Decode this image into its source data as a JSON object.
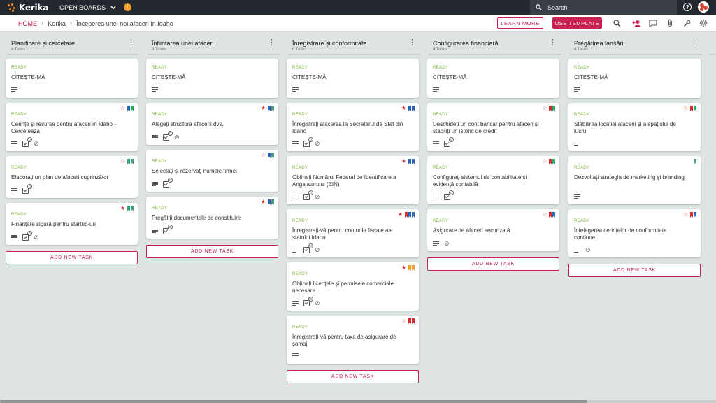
{
  "topbar": {
    "logo_text": "Kerika",
    "open_boards_label": "OPEN BOARDS",
    "search_placeholder": "Search",
    "help_label": "?"
  },
  "header": {
    "breadcrumb": [
      "HOME",
      "Kerika",
      "Începerea unei noi afaceri în Idaho"
    ],
    "learn_more_label": "LEARN MORE",
    "use_template_label": "USE TEMPLATE"
  },
  "colors": {
    "accent": "#c8204f",
    "ready": "#7fb23a",
    "topbar": "#23272e",
    "board_bg": "#dde4e3",
    "tag_blue": "#2e64b8",
    "tag_green": "#2fa66a",
    "tag_red": "#d42f2f",
    "tag_orange": "#f29b26",
    "tag_teal": "#4a9a8a"
  },
  "add_task_label": "ADD NEW TASK",
  "columns": [
    {
      "title": "Planificare și cercetare",
      "count": "4 Tasks",
      "cards": [
        {
          "status": "READY",
          "title": "CITEȘTE-MĂ",
          "star": "",
          "tags": [],
          "icons": [
            "desc"
          ]
        },
        {
          "status": "READY",
          "title": "Cerințe și resurse pentru afaceri în Idaho - Cercetează",
          "star": "outline",
          "tags": [
            "blue",
            "green"
          ],
          "icons": [
            "desc",
            "check",
            "clip"
          ]
        },
        {
          "status": "READY",
          "title": "Elaborați un plan de afaceri cuprinzător",
          "star": "outline",
          "tags": [
            "green",
            "teal"
          ],
          "icons": [
            "desc",
            "check"
          ]
        },
        {
          "status": "READY",
          "title": "Finanțare sigură pentru startup-uri",
          "star": "filled",
          "tags": [
            "green",
            "teal"
          ],
          "icons": [
            "desc",
            "check",
            "clip"
          ]
        }
      ]
    },
    {
      "title": "Înființarea unei afaceri",
      "count": "4 Tasks",
      "cards": [
        {
          "status": "READY",
          "title": "CITEȘTE-MĂ",
          "star": "",
          "tags": [],
          "icons": [
            "desc"
          ]
        },
        {
          "status": "READY",
          "title": "Alegeți structura afacerii dvs.",
          "star": "filled",
          "tags": [
            "blue",
            "teal"
          ],
          "icons": [
            "desc",
            "check",
            "clip"
          ]
        },
        {
          "status": "READY",
          "title": "Selectați și rezervați numele firmei",
          "star": "outline",
          "tags": [
            "blue",
            "teal"
          ],
          "icons": [
            "desc",
            "check"
          ]
        },
        {
          "status": "READY",
          "title": "Pregătiți documentele de constituire",
          "star": "filled",
          "tags": [
            "blue",
            "teal"
          ],
          "icons": [
            "desc",
            "check"
          ]
        }
      ]
    },
    {
      "title": "Înregistrare și conformitate",
      "count": "6 Tasks",
      "cards": [
        {
          "status": "READY",
          "title": "CITEȘTE-MĂ",
          "star": "",
          "tags": [],
          "icons": [
            "desc"
          ]
        },
        {
          "status": "READY",
          "title": "Înregistrați afacerea la Secretarul de Stat din Idaho",
          "star": "filled",
          "tags": [
            "blue",
            "blue"
          ],
          "icons": [
            "desc",
            "check",
            "clip"
          ]
        },
        {
          "status": "READY",
          "title": "Obțineți Numărul Federal de Identificare a Angajatorului (EIN)",
          "star": "filled",
          "tags": [
            "blue",
            "blue"
          ],
          "icons": [
            "desc",
            "check",
            "clip"
          ]
        },
        {
          "status": "READY",
          "title": "Înregistrați-vă pentru conturile fiscale ale statului Idaho",
          "star": "filled",
          "tags": [
            "red",
            "blue",
            "blue"
          ],
          "icons": [
            "desc",
            "check",
            "clip"
          ]
        },
        {
          "status": "READY",
          "title": "Obțineți licențele și permisele comerciale necesare",
          "star": "filled",
          "tags": [
            "orange",
            "orange"
          ],
          "icons": [
            "desc",
            "check",
            "clip"
          ]
        },
        {
          "status": "READY",
          "title": "Înregistrați-vă pentru taxa de asigurare de șomaj",
          "star": "outline",
          "tags": [
            "red",
            "red"
          ],
          "icons": [
            "desc"
          ]
        }
      ]
    },
    {
      "title": "Configurarea financiară",
      "count": "4 Tasks",
      "cards": [
        {
          "status": "READY",
          "title": "CITEȘTE-MĂ",
          "star": "",
          "tags": [],
          "icons": [
            "desc"
          ]
        },
        {
          "status": "READY",
          "title": "Deschideți un cont bancar pentru afaceri și stabiliți un istoric de credit",
          "star": "outline",
          "tags": [
            "red",
            "green"
          ],
          "icons": [
            "desc",
            "check"
          ]
        },
        {
          "status": "READY",
          "title": "Configurați sistemul de contabilitate și evidență contabilă",
          "star": "outline",
          "tags": [
            "red",
            "green"
          ],
          "icons": [
            "desc",
            "check"
          ]
        },
        {
          "status": "READY",
          "title": "Asigurare de afaceri securizată",
          "star": "outline",
          "tags": [
            "red",
            "blue"
          ],
          "icons": [
            "desc",
            "clip"
          ]
        }
      ]
    },
    {
      "title": "Pregătirea lansării",
      "count": "4 Tasks",
      "cards": [
        {
          "status": "READY",
          "title": "CITEȘTE-MĂ",
          "star": "",
          "tags": [],
          "icons": [
            "desc"
          ]
        },
        {
          "status": "READY",
          "title": "Stabilirea locației afacerii și a spațiului de lucru",
          "star": "outline",
          "tags": [
            "red",
            "green"
          ],
          "icons": [
            "desc"
          ]
        },
        {
          "status": "READY",
          "title": "Dezvoltați strategia de marketing și branding",
          "star": "",
          "tags": [
            "teal"
          ],
          "icons": [
            "desc"
          ]
        },
        {
          "status": "READY",
          "title": "Înțelegerea cerințelor de conformitate continue",
          "star": "outline",
          "tags": [
            "red",
            "blue"
          ],
          "icons": [
            "desc",
            "clip"
          ]
        }
      ]
    }
  ]
}
